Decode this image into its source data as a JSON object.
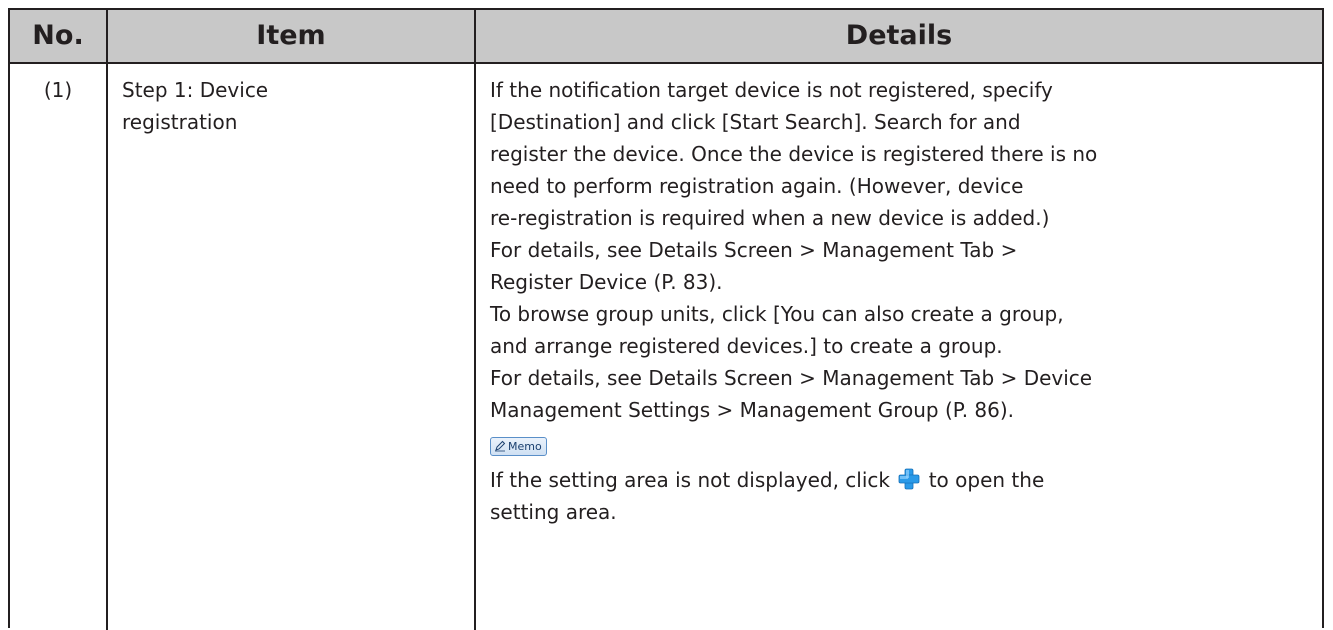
{
  "table": {
    "headers": {
      "no": "No.",
      "item": "Item",
      "details": "Details"
    },
    "rows": [
      {
        "no": "(1)",
        "item_lines": [
          "Step 1: Device",
          "registration"
        ],
        "detail_lines": [
          "If the notification target device is not registered, specify",
          "[Destination] and click [Start Search]. Search for and",
          "register the device. Once the device is registered there is no",
          "need to perform registration again. (However, device",
          "re-registration is required when a new device is added.)",
          "For details, see Details Screen > Management Tab >",
          "Register Device (P. 83).",
          "To browse group units, click [You can also create a group,",
          "and arrange registered devices.] to create a group.",
          "For details, see Details Screen > Management Tab > Device",
          "Management Settings > Management Group (P. 86)."
        ],
        "memo": {
          "label": "Memo",
          "icon": "memo-pencil-icon",
          "text_before_icon": "If the setting area is not displayed, click",
          "inline_icon": "plus-expand-icon",
          "text_after_icon": "to open the",
          "text_last_line": "setting area."
        }
      }
    ]
  },
  "colors": {
    "header_bg": "#c8c8c8",
    "border": "#231f20",
    "text": "#231f20",
    "plus_icon": "#1e90e0"
  }
}
